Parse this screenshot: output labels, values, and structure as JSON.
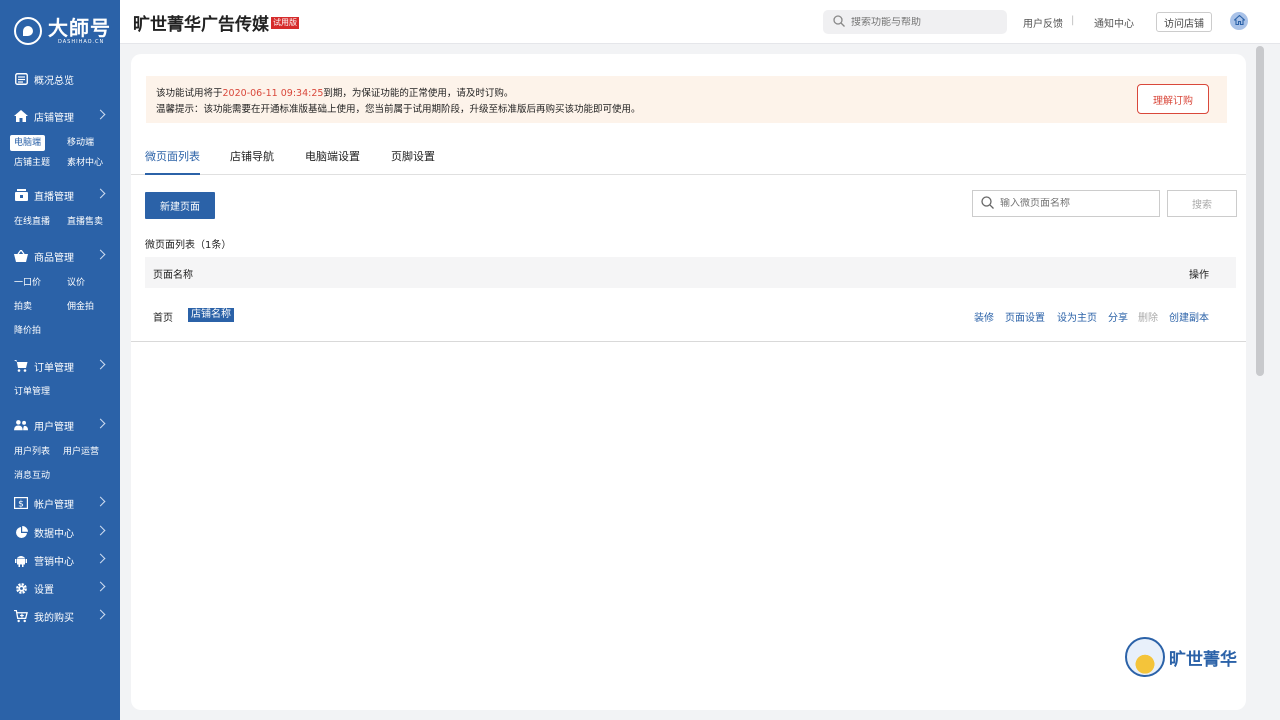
{
  "sidebar": {
    "logo_text": "大師号",
    "logo_sub": "DASHIHAO.CN",
    "overview": "概况总览",
    "store": {
      "label": "店铺管理",
      "subs": [
        "电脑端",
        "移动端",
        "店铺主题",
        "素材中心"
      ]
    },
    "live": {
      "label": "直播管理",
      "subs": [
        "在线直播",
        "直播售卖"
      ]
    },
    "goods": {
      "label": "商品管理",
      "subs": [
        "一口价",
        "议价",
        "拍卖",
        "佣金拍",
        "降价拍"
      ]
    },
    "orders": {
      "label": "订单管理",
      "subs": [
        "订单管理"
      ]
    },
    "users": {
      "label": "用户管理",
      "subs": [
        "用户列表",
        "用户运营",
        "消息互动"
      ]
    },
    "account": "帐户管理",
    "data": "数据中心",
    "marketing": "营销中心",
    "settings": "设置",
    "purchases": "我的购买"
  },
  "header": {
    "company": "旷世菁华广告传媒",
    "trial_badge": "试用版",
    "search_placeholder": "搜索功能与帮助",
    "feedback": "用户反馈",
    "separator": "|",
    "notifications": "通知中心",
    "visit_store": "访问店铺"
  },
  "notice": {
    "line1_prefix": "该功能试用将于",
    "line1_date": "2020-06-11  09:34:25",
    "line1_suffix": "到期，为保证功能的正常使用，请及时订购。",
    "line2": "温馨提示：该功能需要在开通标准版基础上使用，您当前属于试用期阶段，升级至标准版后再购买该功能即可使用。",
    "subscribe_button": "理解订购"
  },
  "tabs": [
    "微页面列表",
    "店铺导航",
    "电脑端设置",
    "页脚设置"
  ],
  "toolbar": {
    "new_page": "新建页面",
    "search_placeholder": "输入微页面名称",
    "search_button": "搜索"
  },
  "list": {
    "title": "微页面列表（1条）",
    "columns": {
      "name": "页面名称",
      "actions": "操作"
    },
    "rows": [
      {
        "name": "首页",
        "tag": "店铺名称",
        "actions": [
          "装修",
          "页面设置",
          "设为主页",
          "分享",
          "删除",
          "创建副本"
        ]
      }
    ]
  },
  "brand": {
    "text": "旷世菁华"
  },
  "colors": {
    "primary": "#2b62a8",
    "danger": "#d9483b",
    "notice_bg": "#fdf3ea"
  }
}
